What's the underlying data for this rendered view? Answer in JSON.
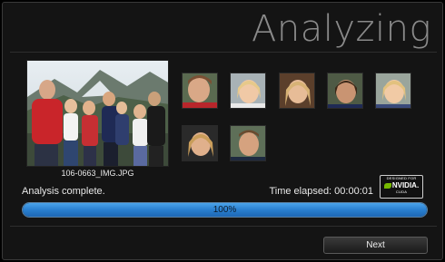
{
  "header": {
    "title": "Analyzing"
  },
  "photo": {
    "caption": "106-0663_IMG.JPG"
  },
  "faces": [
    {
      "name": "face-1"
    },
    {
      "name": "face-2"
    },
    {
      "name": "face-3"
    },
    {
      "name": "face-4"
    },
    {
      "name": "face-5"
    },
    {
      "name": "face-6"
    },
    {
      "name": "face-7"
    }
  ],
  "status": {
    "message": "Analysis complete.",
    "elapsed": "Time elapsed: 00:00:01"
  },
  "badge": {
    "line1": "DESIGNED FOR",
    "brand": "NVIDIA.",
    "line2": "CUDA"
  },
  "progress": {
    "percent": 100,
    "label": "100%"
  },
  "footer": {
    "next_label": "Next"
  },
  "colors": {
    "accent": "#2a7fcf",
    "background": "#141414",
    "title": "#8a8a8a",
    "nvidia_green": "#76b900"
  }
}
